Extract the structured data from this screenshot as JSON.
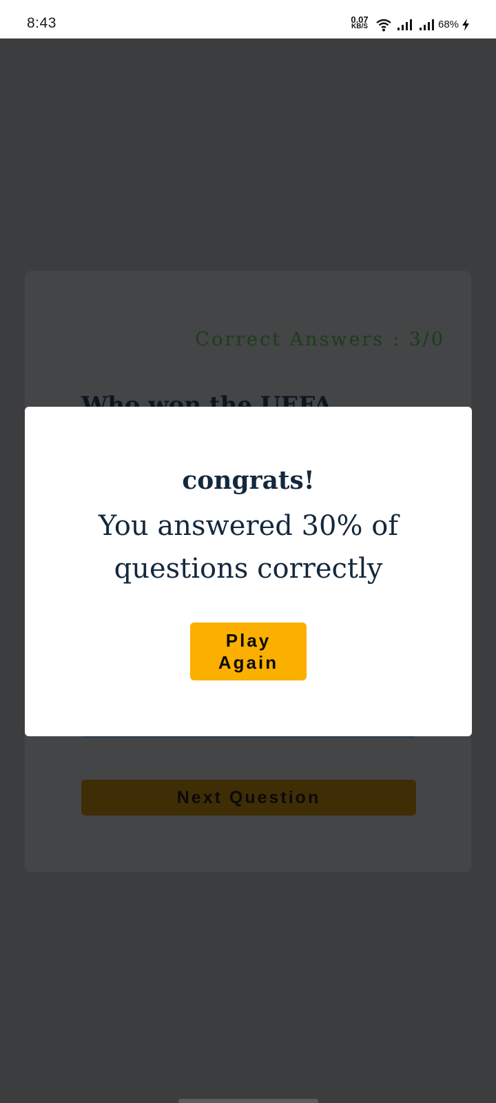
{
  "status_bar": {
    "time": "8:43",
    "net_speed_value": "0.07",
    "net_speed_unit": "KB/S",
    "battery": "68%",
    "icons": [
      "wifi-icon",
      "signal-icon",
      "signal-icon",
      "charging-bolt-icon"
    ]
  },
  "quiz": {
    "correct_answers": "Correct Answers : 3/0",
    "question_peek": "Who won the UEFA",
    "next_label": "Next Question"
  },
  "modal": {
    "title": "congrats!",
    "message": "You answered 30% of questions correctly",
    "play_again_label": "Play Again"
  },
  "colors": {
    "accent": "#fbaf00",
    "text_dark": "#14283d",
    "overlay": "#3c3d3f"
  }
}
